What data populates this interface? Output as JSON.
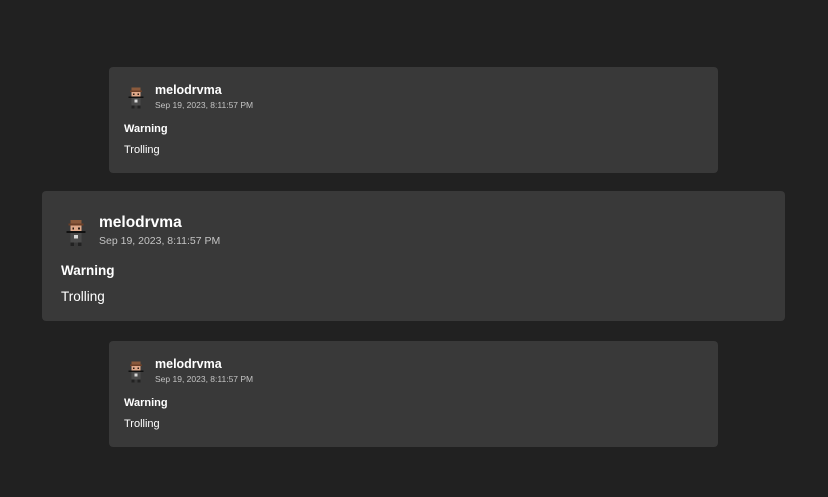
{
  "cards": [
    {
      "username": "melodrvma",
      "timestamp": "Sep 19, 2023, 8:11:57 PM",
      "title": "Warning",
      "reason": "Trolling"
    },
    {
      "username": "melodrvma",
      "timestamp": "Sep 19, 2023, 8:11:57 PM",
      "title": "Warning",
      "reason": "Trolling"
    },
    {
      "username": "melodrvma",
      "timestamp": "Sep 19, 2023, 8:11:57 PM",
      "title": "Warning",
      "reason": "Trolling"
    }
  ],
  "colors": {
    "background": "#212121",
    "card": "#393939",
    "text": "#ffffff",
    "muted_text": "#c4c4c4"
  },
  "avatar_icon": "pixel-avatar-icon"
}
